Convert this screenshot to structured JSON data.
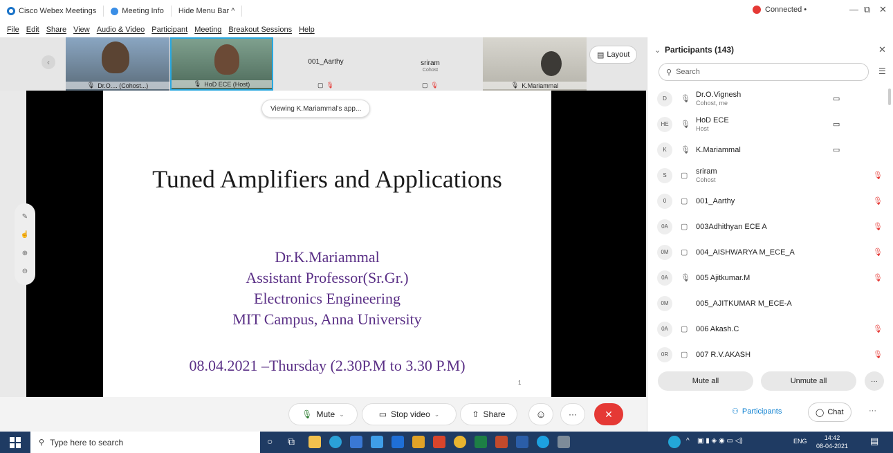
{
  "titlebar": {
    "app_name": "Cisco Webex Meetings",
    "meeting_info": "Meeting Info",
    "hide_menu": "Hide Menu Bar ^",
    "connected": "Connected •",
    "minimize": "—",
    "restore": "⧉",
    "close": "✕"
  },
  "menu": [
    "File",
    "Edit",
    "Share",
    "View",
    "Audio & Video",
    "Participant",
    "Meeting",
    "Breakout Sessions",
    "Help"
  ],
  "strip": {
    "tiles": [
      {
        "label": "Dr.O.... (Cohost...)"
      },
      {
        "label": "HoD ECE (Host)"
      },
      {
        "name": "001_Aarthy"
      },
      {
        "name": "sriram",
        "sub": "Cohost"
      },
      {
        "label": "K.Mariammal"
      }
    ],
    "layout": "Layout"
  },
  "viewing": "Viewing K.Mariammal's app...",
  "slide": {
    "title": "Tuned Amplifiers and Applications",
    "author": "Dr.K.Mariammal",
    "position": "Assistant Professor(Sr.Gr.)",
    "dept": "Electronics Engineering",
    "campus": "MIT Campus, Anna University",
    "date": "08.04.2021 –Thursday (2.30P.M  to 3.30 P.M)",
    "page": "1"
  },
  "controls": {
    "mute": "Mute",
    "stop_video": "Stop video",
    "share": "Share",
    "more": "···"
  },
  "panel": {
    "title": "Participants (143)",
    "search_placeholder": "Search",
    "mute_all": "Mute all",
    "unmute_all": "Unmute all",
    "more": "···",
    "participants": [
      {
        "initials": "D",
        "name": "Dr.O.Vignesh",
        "sub": "Cohost, me"
      },
      {
        "initials": "HE",
        "name": "HoD ECE",
        "sub": "Host"
      },
      {
        "initials": "K",
        "name": "K.Mariammal",
        "sub": ""
      },
      {
        "initials": "S",
        "name": "sriram",
        "sub": "Cohost"
      },
      {
        "initials": "0",
        "name": "001_Aarthy",
        "sub": ""
      },
      {
        "initials": "0A",
        "name": "003Adhithyan ECE A",
        "sub": ""
      },
      {
        "initials": "0M",
        "name": "004_AISHWARYA M_ECE_A",
        "sub": ""
      },
      {
        "initials": "0A",
        "name": "005 Ajitkumar.M",
        "sub": ""
      },
      {
        "initials": "0M",
        "name": "005_AJITKUMAR M_ECE-A",
        "sub": ""
      },
      {
        "initials": "0A",
        "name": "006 Akash.C",
        "sub": ""
      },
      {
        "initials": "0R",
        "name": "007 R.V.AKASH",
        "sub": ""
      }
    ],
    "tab_participants": "Participants",
    "tab_chat": "Chat",
    "tab_more": "···"
  },
  "taskbar": {
    "search": "Type here to search",
    "lang": "ENG",
    "time": "14:42",
    "date": "08-04-2021"
  },
  "colors": {
    "accent": "#0a7fd0",
    "red": "#e53935",
    "taskbar": "#1f3b63"
  }
}
